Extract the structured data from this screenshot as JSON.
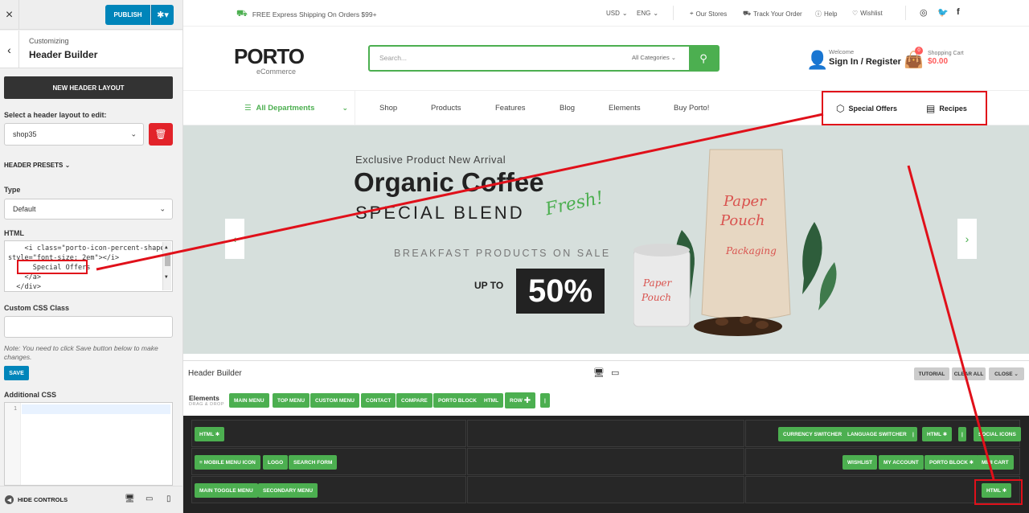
{
  "panel": {
    "close": "×",
    "publish_label": "PUBLISH",
    "gear": "✱",
    "crumb_small": "Customizing",
    "crumb_title": "Header Builder",
    "new_layout": "NEW HEADER LAYOUT",
    "select_label": "Select a header layout to edit:",
    "layout_value": "shop35",
    "presets": "HEADER PRESETS",
    "type_label": "Type",
    "type_value": "Default",
    "html_label": "HTML",
    "code_lines": [
      "    <i class=\"porto-icon-percent-shape\"",
      "style=\"font-size: 2em\"></i>",
      "      Special Offers",
      "    </a>",
      "  </div>"
    ],
    "css_class_label": "Custom CSS Class",
    "note": "Note: You need to click Save button below to make changes.",
    "save": "SAVE",
    "additional_css": "Additional CSS",
    "line_no": "1",
    "hide_controls": "HIDE CONTROLS"
  },
  "topbar": {
    "shipping": "FREE Express Shipping On Orders $99+",
    "currency": "USD",
    "lang": "ENG",
    "stores": "Our Stores",
    "track": "Track Your Order",
    "help": "Help",
    "wishlist": "Wishlist"
  },
  "header": {
    "logo": "PORTO",
    "logo_sub": "eCommerce",
    "search_placeholder": "Search...",
    "categories": "All Categories",
    "welcome": "Welcome",
    "signin": "Sign In / Register",
    "cart_label": "Shopping Cart",
    "cart_value": "$0.00",
    "cart_count": "0"
  },
  "nav": {
    "departments": "All Departments",
    "links": [
      "Shop",
      "Products",
      "Features",
      "Blog",
      "Elements",
      "Buy Porto!"
    ],
    "special_offers": "Special Offers",
    "recipes": "Recipes"
  },
  "hero": {
    "eyebrow": "Exclusive Product New Arrival",
    "title": "Organic Coffee",
    "subtitle": "SPECIAL BLEND",
    "script": "Fresh!",
    "sale": "BREAKFAST PRODUCTS ON SALE",
    "upto": "UP TO",
    "percent": "50%"
  },
  "builder": {
    "title": "Header Builder",
    "tutorial": "TUTORIAL",
    "clear_all": "CLEAR ALL",
    "close": "CLOSE",
    "elements_label": "Elements",
    "elements_sub": "DRAG & DROP",
    "elements": [
      "MAIN MENU",
      "TOP MENU",
      "CUSTOM MENU",
      "CONTACT",
      "COMPARE",
      "PORTO BLOCK",
      "HTML",
      "ROW",
      "|"
    ],
    "row1_left": [
      "HTML"
    ],
    "row1_right": [
      "CURRENCY SWITCHER",
      "LANGUAGE SWITCHER",
      "|",
      "HTML",
      "|",
      "SOCIAL ICONS"
    ],
    "row2_left": [
      "≡ MOBILE MENU ICON",
      "LOGO",
      "SEARCH FORM"
    ],
    "row2_right": [
      "WISHLIST",
      "MY ACCOUNT",
      "PORTO BLOCK",
      "MINI CART"
    ],
    "row3_left": [
      "MAIN TOGGLE MENU",
      "SECONDARY MENU"
    ],
    "row3_right": [
      "HTML"
    ]
  }
}
